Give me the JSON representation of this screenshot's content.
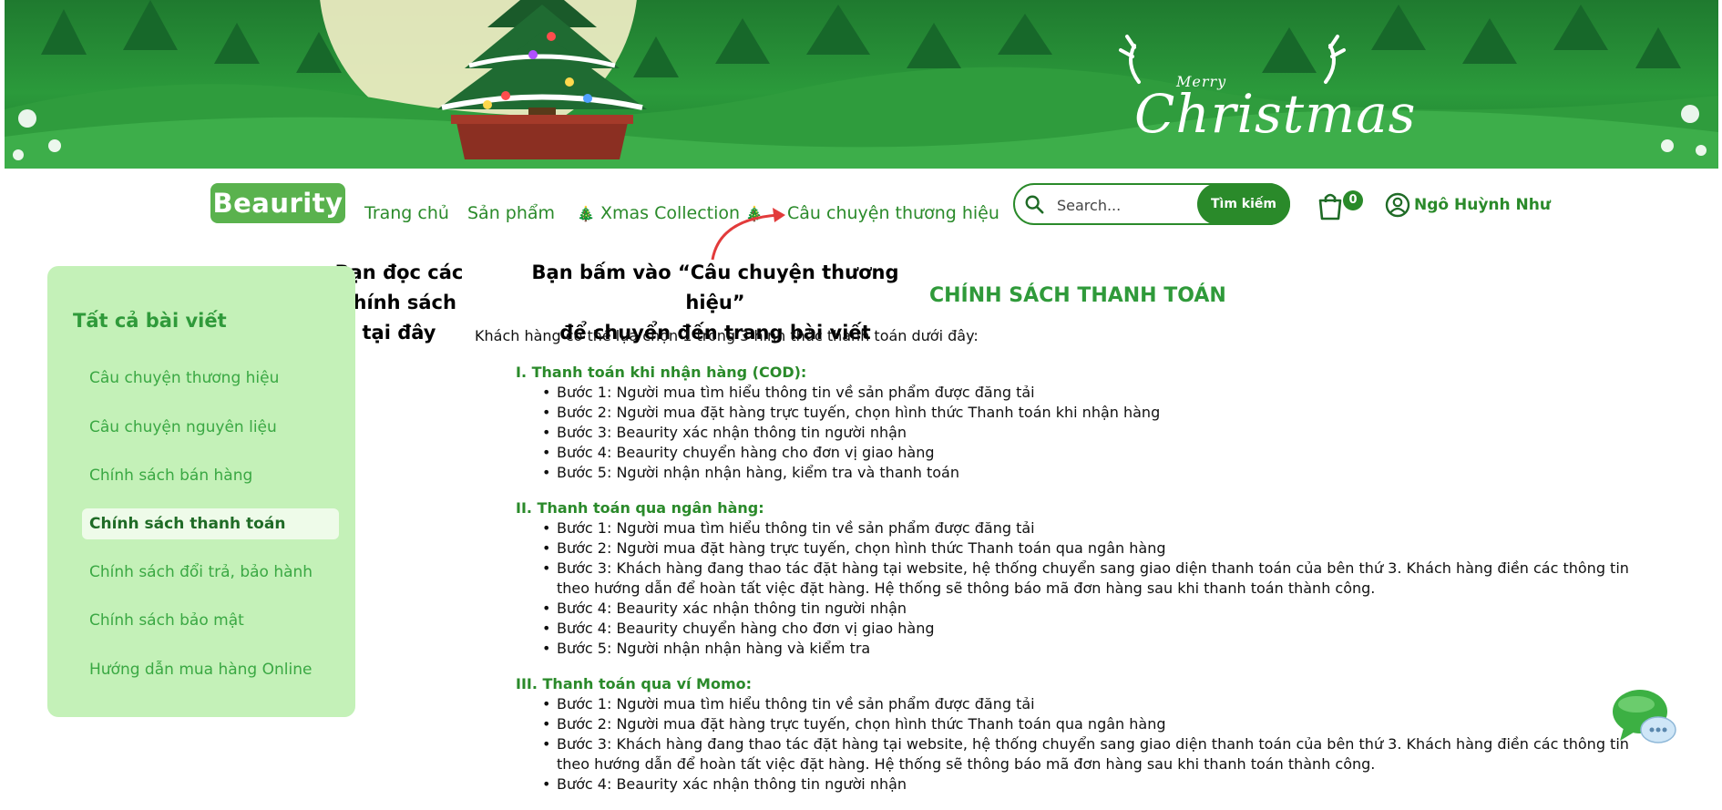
{
  "banner": {
    "greeting_merry": "Merry",
    "greeting_christmas": "Christmas"
  },
  "nav": {
    "logo": "Beaurity",
    "links": [
      "Trang chủ",
      "Sản phẩm",
      "Xmas Collection",
      "Câu chuyện thương hiệu"
    ],
    "search_placeholder": "Search...",
    "search_button": "Tìm kiếm",
    "cart_count": "0",
    "user_name": "Ngô Huỳnh Như"
  },
  "annotations": {
    "left_line1": "Bạn đọc các",
    "left_line2": "chính sách",
    "left_line3": "tại đây",
    "center_line1": "Bạn bấm vào “Câu chuyện thương hiệu”",
    "center_line2": "để chuyển đến trang bài viết"
  },
  "sidebar": {
    "title": "Tất cả bài viết",
    "items": [
      "Câu chuyện thương hiệu",
      "Câu chuyện nguyên liệu",
      "Chính sách bán hàng",
      "Chính sách thanh toán",
      "Chính sách đổi trả, bảo hành",
      "Chính sách bảo mật",
      "Hướng dẫn mua hàng Online"
    ],
    "active_index": 3
  },
  "article": {
    "title": "CHÍNH SÁCH THANH TOÁN",
    "intro": "Khách hàng có thể lựa chọn 1 trong 3 hình thức thanh toán dưới đây:",
    "sections": [
      {
        "heading": "I. Thanh toán khi nhận hàng (COD):",
        "steps": [
          "Bước 1: Người mua tìm hiểu thông tin về sản phẩm được đăng tải",
          "Bước 2: Người mua đặt hàng trực tuyến, chọn hình thức Thanh toán khi nhận hàng",
          "Bước 3: Beaurity xác nhận thông tin người nhận",
          "Bước 4: Beaurity chuyển hàng cho đơn vị giao hàng",
          "Bước 5: Người nhận nhận hàng, kiểm tra và thanh toán"
        ]
      },
      {
        "heading": "II. Thanh toán qua ngân hàng:",
        "steps": [
          "Bước 1: Người mua tìm hiểu thông tin về sản phẩm được đăng tải",
          "Bước 2: Người mua đặt hàng trực tuyến, chọn hình thức Thanh toán qua ngân hàng",
          "Bước 3: Khách hàng đang thao tác đặt hàng tại website, hệ thống chuyển sang giao diện thanh toán của bên thứ 3. Khách hàng điền các thông tin theo hướng dẫn để hoàn tất việc đặt hàng. Hệ thống sẽ thông báo mã đơn hàng sau khi thanh toán thành công.",
          "Bước 4: Beaurity xác nhận thông tin người nhận",
          "Bước 4: Beaurity chuyển hàng cho đơn vị giao hàng",
          "Bước 5: Người nhận nhận hàng và kiểm tra"
        ]
      },
      {
        "heading": "III. Thanh toán qua ví Momo:",
        "steps": [
          "Bước 1: Người mua tìm hiểu thông tin về sản phẩm được đăng tải",
          "Bước 2: Người mua đặt hàng trực tuyến, chọn hình thức Thanh toán qua ngân hàng",
          "Bước 3: Khách hàng đang thao tác đặt hàng tại website, hệ thống chuyển sang giao diện thanh toán của bên thứ 3. Khách hàng điền các thông tin theo hướng dẫn để hoàn tất việc đặt hàng. Hệ thống sẽ thông báo mã đơn hàng sau khi thanh toán thành công.",
          "Bước 4: Beaurity xác nhận thông tin người nhận"
        ]
      }
    ]
  },
  "colors": {
    "brand_green": "#2a8a2a",
    "sidebar_bg": "#c4f1b8",
    "logo_bg": "#5ab24e",
    "arrow_red": "#e23b3b"
  }
}
